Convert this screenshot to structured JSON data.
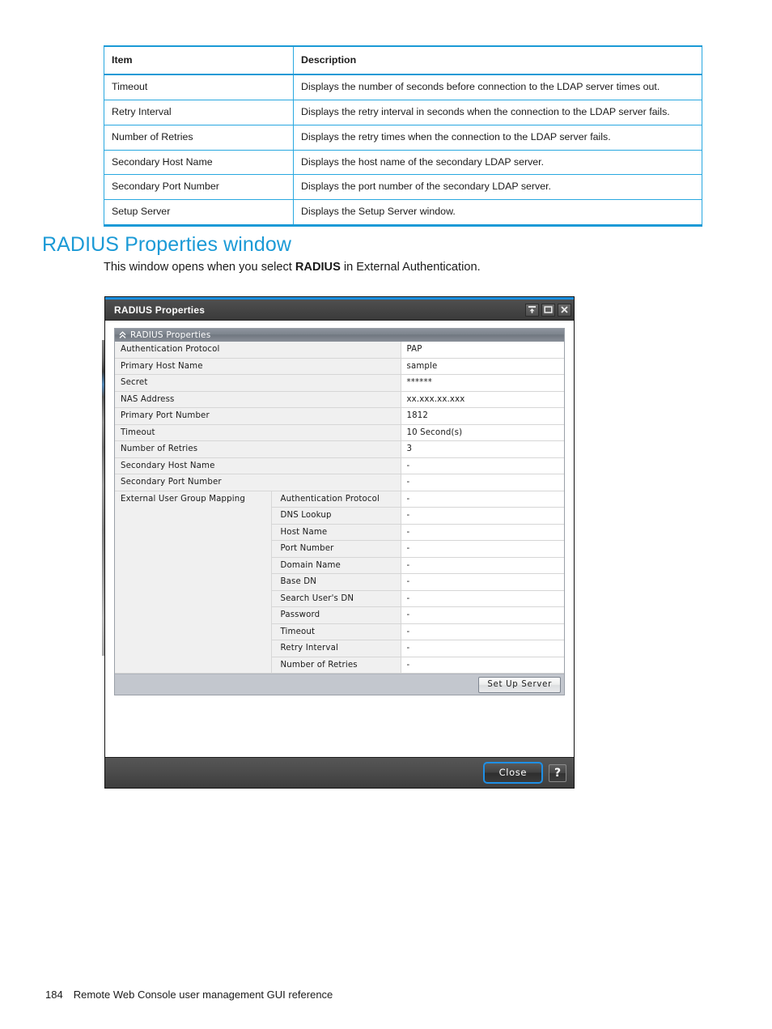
{
  "doc_table": {
    "headers": [
      "Item",
      "Description"
    ],
    "rows": [
      [
        "Timeout",
        "Displays the number of seconds before connection to the LDAP server times out."
      ],
      [
        "Retry Interval",
        "Displays the retry interval in seconds when the connection to the LDAP server fails."
      ],
      [
        "Number of Retries",
        "Displays the retry times when the connection to the LDAP server fails."
      ],
      [
        "Secondary Host Name",
        "Displays the host name of the secondary LDAP server."
      ],
      [
        "Secondary Port Number",
        "Displays the port number of the secondary LDAP server."
      ],
      [
        "Setup Server",
        "Displays the Setup Server window."
      ]
    ]
  },
  "section": {
    "heading": "RADIUS Properties window",
    "intro_before": "This window opens when you select ",
    "intro_bold": "RADIUS",
    "intro_after": " in External Authentication."
  },
  "dialog": {
    "title": "RADIUS Properties",
    "window_buttons": {
      "minimize": "dock-icon",
      "maximize": "maximize-icon",
      "close": "close-icon"
    },
    "panel": {
      "header": "RADIUS Properties",
      "collapse_icon": "chevron-double-up-icon",
      "rows": [
        {
          "label": "Authentication Protocol",
          "value": "PAP"
        },
        {
          "label": "Primary Host Name",
          "value": "sample"
        },
        {
          "label": "Secret",
          "value": "******"
        },
        {
          "label": "NAS Address",
          "value": "xx.xxx.xx.xxx"
        },
        {
          "label": "Primary Port Number",
          "value": "1812"
        },
        {
          "label": "Timeout",
          "value": "10 Second(s)"
        },
        {
          "label": "Number of Retries",
          "value": "3"
        },
        {
          "label": "Secondary Host Name",
          "value": "-"
        },
        {
          "label": "Secondary Port Number",
          "value": "-"
        }
      ],
      "group": {
        "label": "External User Group Mapping",
        "rows": [
          {
            "label": "Authentication Protocol",
            "value": "-"
          },
          {
            "label": "DNS Lookup",
            "value": "-"
          },
          {
            "label": "Host Name",
            "value": "-"
          },
          {
            "label": "Port Number",
            "value": "-"
          },
          {
            "label": "Domain Name",
            "value": "-"
          },
          {
            "label": "Base DN",
            "value": "-"
          },
          {
            "label": "Search User's DN",
            "value": "-"
          },
          {
            "label": "Password",
            "value": "-"
          },
          {
            "label": "Timeout",
            "value": "-"
          },
          {
            "label": "Retry Interval",
            "value": "-"
          },
          {
            "label": "Number of Retries",
            "value": "-"
          }
        ]
      },
      "setup_button": "Set Up Server"
    },
    "footer": {
      "close_button": "Close",
      "help_button": "?"
    }
  },
  "page_footer": {
    "page_number": "184",
    "text": "Remote Web Console user management GUI reference"
  },
  "colors": {
    "accent_blue": "#1b9ad6",
    "table_border": "#29a8e0",
    "focus_ring": "#1e8fe6",
    "panel_footer": "#c3c7ce"
  }
}
